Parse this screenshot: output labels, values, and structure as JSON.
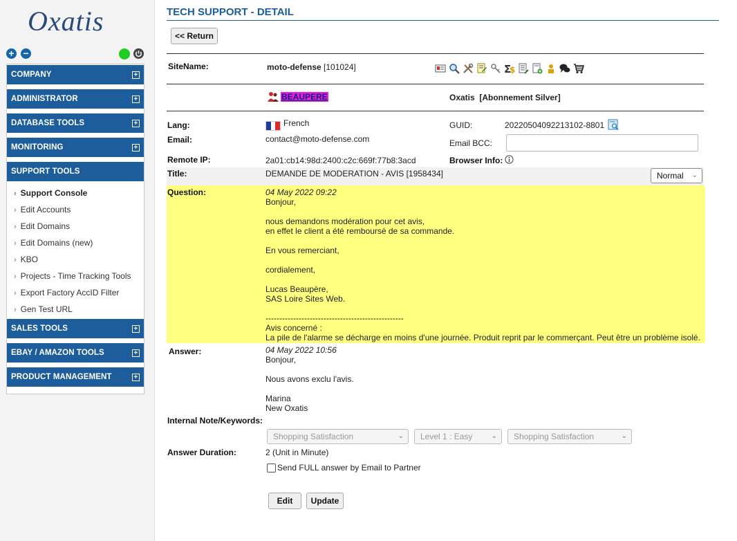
{
  "brand": {
    "logo_text": "Oxatis",
    "accent": "#1d5d9b"
  },
  "sidebar": {
    "controls": [
      "plus-icon",
      "minus-icon",
      "status-online-icon",
      "power-icon"
    ],
    "menu": {
      "company": "COMPANY",
      "administrator": "ADMINISTRATOR",
      "database_tools": "DATABASE TOOLS",
      "monitoring": "MONITORING",
      "support_tools": "SUPPORT TOOLS",
      "support_items": [
        "Support Console",
        "Edit Accounts",
        "Edit Domains",
        "Edit Domains (new)",
        "KBO",
        "Projects - Time Tracking Tools",
        "Export Factory AccID Filter",
        "Gen Test URL"
      ],
      "sales_tools": "SALES TOOLS",
      "ebay_amazon": "EBAY / AMAZON TOOLS",
      "product_management": "PRODUCT MANAGEMENT"
    }
  },
  "page": {
    "title": "TECH SUPPORT - DETAIL",
    "return_label": "<< Return"
  },
  "site": {
    "label": "SiteName:",
    "name": "moto-defense",
    "id": "[101024]",
    "account_name": "BEAUPERE",
    "company": "Oxatis",
    "subscription": "[Abonnement Silver]"
  },
  "details": {
    "lang_label": "Lang:",
    "lang_value": "French",
    "guid_label": "GUID:",
    "guid_value": "20220504092213102-8801",
    "email_label": "Email:",
    "email_value": "contact@moto-defense.com",
    "email_bcc_label": "Email BCC:",
    "email_bcc_value": "",
    "remote_ip_label": "Remote IP:",
    "remote_ip_value": "2a01:cb14:98d:2400:c2c:669f:77b8:3acd",
    "browser_info_label": "Browser Info:",
    "title_label": "Title:",
    "title_value": "DEMANDE DE MODERATION - AVIS [1958434]",
    "priority": "Normal"
  },
  "question": {
    "label": "Question:",
    "date": "04 May 2022 09:22",
    "lines": [
      "Bonjour,",
      "",
      "nous demandons modération pour cet avis,",
      "en effet le client a été remboursé de sa commande.",
      "",
      "En vous remerciant,",
      "",
      "cordialement,",
      "",
      "Lucas Beaupère,",
      "SAS Loire Sites Web.",
      "",
      "--------------------------------------------------",
      "Avis concerné :",
      "La pile de l'alarme se décharge en moins d'une journée. Produit reprit par le commerçant. Peut être un problème isolé."
    ]
  },
  "answer": {
    "label": "Answer:",
    "date": "04 May 2022 10:56",
    "lines": [
      "Bonjour,",
      "",
      "Nous avons exclu l'avis.",
      "",
      "Marina",
      "New Oxatis"
    ]
  },
  "internal": {
    "label": "Internal Note/Keywords:",
    "select1": "Shopping Satisfaction",
    "select2": "Level 1 : Easy",
    "select3": "Shopping Satisfaction"
  },
  "duration": {
    "label": "Answer Duration:",
    "value": "2 (Unit in Minute)"
  },
  "send_full_label": "Send FULL answer by Email to Partner",
  "actions": {
    "edit": "Edit",
    "update": "Update"
  }
}
